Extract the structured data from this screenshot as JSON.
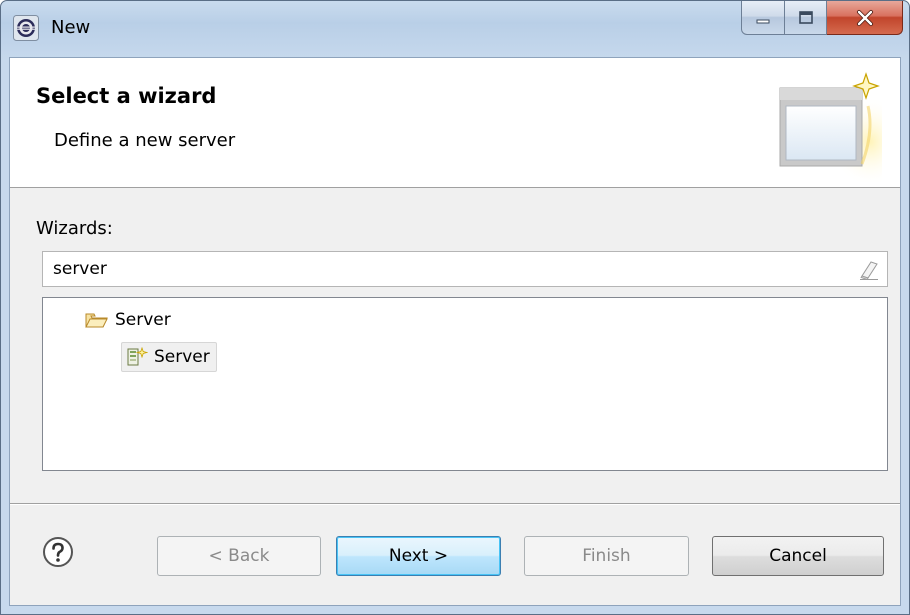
{
  "window": {
    "title": "New"
  },
  "header": {
    "title": "Select a wizard",
    "description": "Define a new server"
  },
  "wizards": {
    "label": "Wizards:",
    "filter_value": "server",
    "tree": [
      {
        "label": "Server",
        "icon": "folder-open-icon",
        "expanded": true,
        "children": [
          {
            "label": "Server",
            "icon": "new-server-icon",
            "selected": true
          }
        ]
      }
    ]
  },
  "buttons": {
    "back": "< Back",
    "next": "Next >",
    "finish": "Finish",
    "cancel": "Cancel"
  },
  "icons": {
    "app": "eclipse-icon",
    "help": "help-icon",
    "clear_filter": "eraser-icon",
    "banner": "new-wizard-banner-icon"
  },
  "colors": {
    "default_button_border": "#3c7fb1",
    "close_button": "#c1452c",
    "title_bar": "#b9cfe7"
  }
}
